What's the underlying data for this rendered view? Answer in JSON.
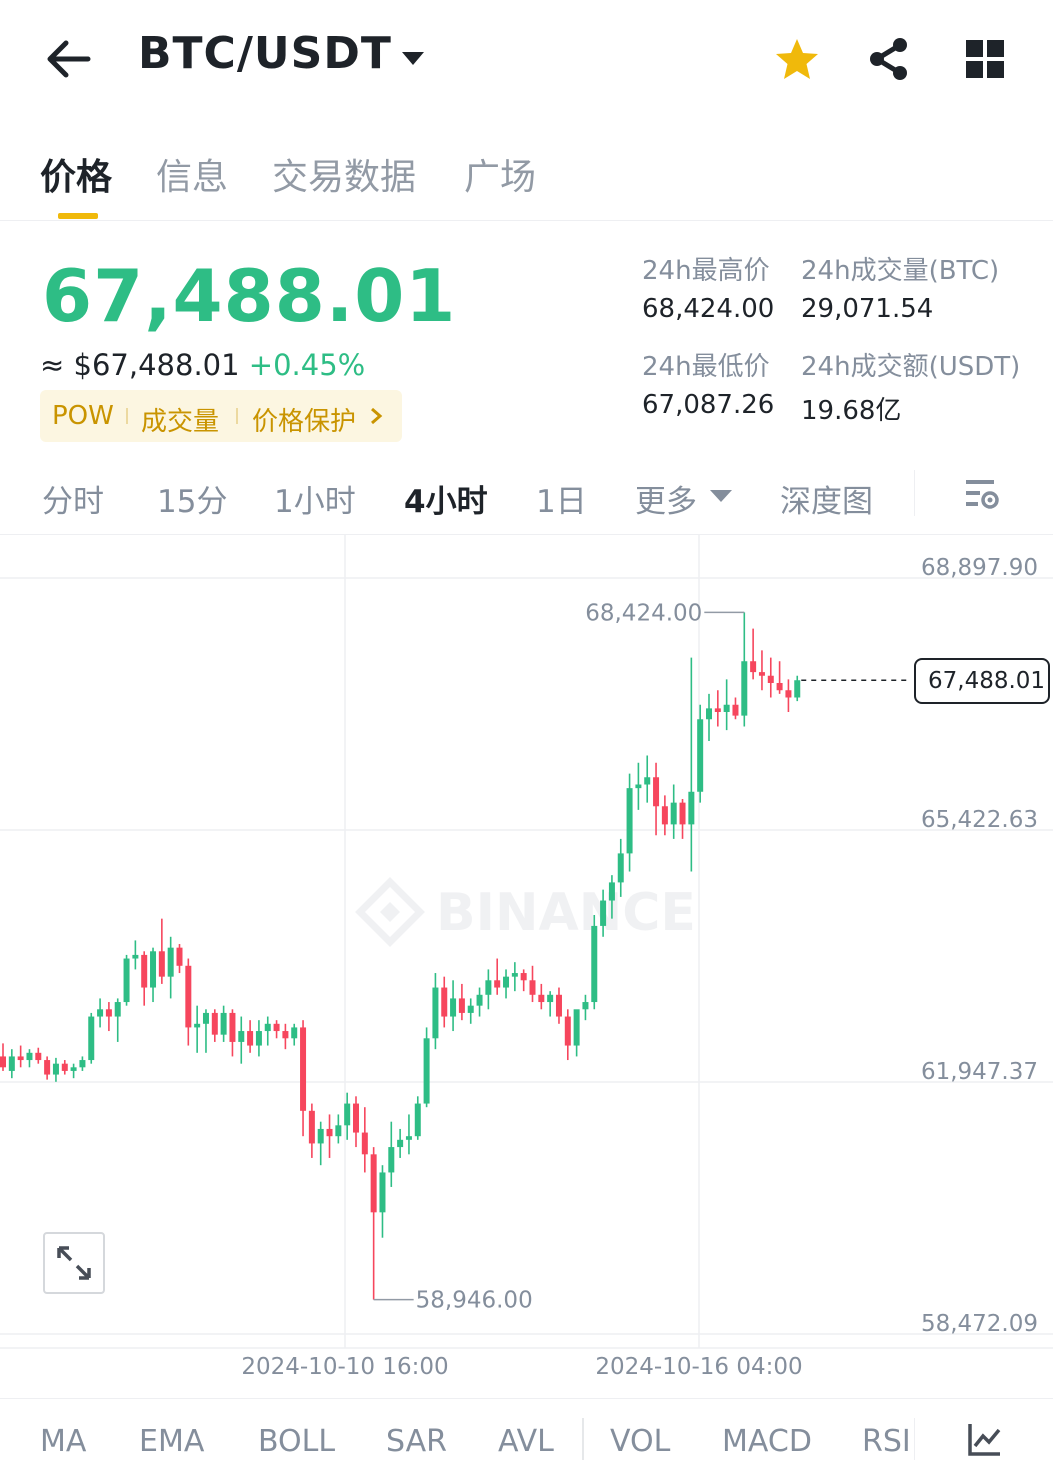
{
  "header": {
    "title": "BTC/USDT",
    "icons": [
      "back-arrow-icon",
      "chevron-down-icon",
      "star-icon",
      "share-icon",
      "grid-icon"
    ],
    "star_color": "#f0b90b"
  },
  "tabs": [
    {
      "label": "价格",
      "active": true
    },
    {
      "label": "信息",
      "active": false
    },
    {
      "label": "交易数据",
      "active": false
    },
    {
      "label": "广场",
      "active": false
    }
  ],
  "price": {
    "last": "67,488.01",
    "approx": "≈ $67,488.01",
    "change": "+0.45%",
    "up_color": "#2ebd85",
    "down_color": "#f6465d"
  },
  "tags": [
    "POW",
    "成交量",
    "价格保护"
  ],
  "stats": {
    "high_label": "24h最高价",
    "high_value": "68,424.00",
    "vol_btc_label": "24h成交量(BTC)",
    "vol_btc_value": "29,071.54",
    "low_label": "24h最低价",
    "low_value": "67,087.26",
    "vol_usdt_label": "24h成交额(USDT)",
    "vol_usdt_value": "19.68亿"
  },
  "intervals": [
    {
      "label": "分时",
      "active": false
    },
    {
      "label": "15分",
      "active": false
    },
    {
      "label": "1小时",
      "active": false
    },
    {
      "label": "4小时",
      "active": true
    },
    {
      "label": "1日",
      "active": false
    },
    {
      "label": "更多",
      "active": false
    },
    {
      "label": "深度图",
      "active": false
    }
  ],
  "chart": {
    "watermark": "BINANCE",
    "y_ticks": [
      "68,897.90",
      "65,422.63",
      "61,947.37",
      "58,472.09"
    ],
    "x_ticks": [
      "2024-10-10 16:00",
      "2024-10-16 04:00"
    ],
    "high_marker": "68,424.00",
    "low_marker": "58,946.00",
    "last_price": "67,488.01"
  },
  "chart_data": {
    "type": "candlestick",
    "interval": "4小时",
    "y_ticks": [
      68897.9,
      65422.63,
      61947.37,
      58472.09
    ],
    "x_ticks": [
      "2024-10-10 16:00",
      "2024-10-16 04:00"
    ],
    "high": 68424.0,
    "low": 58946.0,
    "last": 67488.01,
    "candles": [
      {
        "o": 62300,
        "h": 62480,
        "l": 62100,
        "c": 62150
      },
      {
        "o": 62100,
        "h": 62400,
        "l": 62000,
        "c": 62300
      },
      {
        "o": 62300,
        "h": 62450,
        "l": 62150,
        "c": 62250
      },
      {
        "o": 62250,
        "h": 62400,
        "l": 62150,
        "c": 62350
      },
      {
        "o": 62350,
        "h": 62420,
        "l": 62200,
        "c": 62250
      },
      {
        "o": 62250,
        "h": 62300,
        "l": 61980,
        "c": 62050
      },
      {
        "o": 62050,
        "h": 62280,
        "l": 61950,
        "c": 62200
      },
      {
        "o": 62200,
        "h": 62250,
        "l": 62050,
        "c": 62100
      },
      {
        "o": 62100,
        "h": 62200,
        "l": 62000,
        "c": 62150
      },
      {
        "o": 62150,
        "h": 62300,
        "l": 62100,
        "c": 62250
      },
      {
        "o": 62250,
        "h": 62900,
        "l": 62200,
        "c": 62850
      },
      {
        "o": 62850,
        "h": 63100,
        "l": 62700,
        "c": 62950
      },
      {
        "o": 62950,
        "h": 63050,
        "l": 62650,
        "c": 62850
      },
      {
        "o": 62850,
        "h": 63100,
        "l": 62500,
        "c": 63050
      },
      {
        "o": 63050,
        "h": 63700,
        "l": 63000,
        "c": 63650
      },
      {
        "o": 63650,
        "h": 63900,
        "l": 63500,
        "c": 63700
      },
      {
        "o": 63700,
        "h": 63750,
        "l": 63000,
        "c": 63250
      },
      {
        "o": 63250,
        "h": 63800,
        "l": 63050,
        "c": 63750
      },
      {
        "o": 63750,
        "h": 64200,
        "l": 63300,
        "c": 63400
      },
      {
        "o": 63400,
        "h": 63950,
        "l": 63100,
        "c": 63800
      },
      {
        "o": 63800,
        "h": 63850,
        "l": 63450,
        "c": 63550
      },
      {
        "o": 63550,
        "h": 63650,
        "l": 62450,
        "c": 62700
      },
      {
        "o": 62700,
        "h": 63000,
        "l": 62350,
        "c": 62750
      },
      {
        "o": 62750,
        "h": 62950,
        "l": 62350,
        "c": 62900
      },
      {
        "o": 62900,
        "h": 62950,
        "l": 62500,
        "c": 62600
      },
      {
        "o": 62600,
        "h": 63000,
        "l": 62500,
        "c": 62900
      },
      {
        "o": 62900,
        "h": 62950,
        "l": 62300,
        "c": 62500
      },
      {
        "o": 62500,
        "h": 62850,
        "l": 62200,
        "c": 62650
      },
      {
        "o": 62650,
        "h": 62800,
        "l": 62350,
        "c": 62450
      },
      {
        "o": 62450,
        "h": 62800,
        "l": 62300,
        "c": 62650
      },
      {
        "o": 62650,
        "h": 62850,
        "l": 62450,
        "c": 62750
      },
      {
        "o": 62750,
        "h": 62800,
        "l": 62550,
        "c": 62650
      },
      {
        "o": 62650,
        "h": 62750,
        "l": 62400,
        "c": 62550
      },
      {
        "o": 62550,
        "h": 62750,
        "l": 62450,
        "c": 62700
      },
      {
        "o": 62700,
        "h": 62800,
        "l": 61200,
        "c": 61550
      },
      {
        "o": 61550,
        "h": 61650,
        "l": 60900,
        "c": 61100
      },
      {
        "o": 61100,
        "h": 61400,
        "l": 60800,
        "c": 61300
      },
      {
        "o": 61300,
        "h": 61500,
        "l": 60900,
        "c": 61200
      },
      {
        "o": 61200,
        "h": 61500,
        "l": 61100,
        "c": 61350
      },
      {
        "o": 61350,
        "h": 61800,
        "l": 61150,
        "c": 61650
      },
      {
        "o": 61650,
        "h": 61750,
        "l": 61050,
        "c": 61250
      },
      {
        "o": 61250,
        "h": 61600,
        "l": 60700,
        "c": 60950
      },
      {
        "o": 60950,
        "h": 61050,
        "l": 58946,
        "c": 60150
      },
      {
        "o": 60150,
        "h": 60800,
        "l": 59800,
        "c": 60700
      },
      {
        "o": 60700,
        "h": 61400,
        "l": 60500,
        "c": 61050
      },
      {
        "o": 61050,
        "h": 61300,
        "l": 60900,
        "c": 61150
      },
      {
        "o": 61150,
        "h": 61500,
        "l": 60950,
        "c": 61200
      },
      {
        "o": 61200,
        "h": 61750,
        "l": 61150,
        "c": 61650
      },
      {
        "o": 61650,
        "h": 62700,
        "l": 61600,
        "c": 62550
      },
      {
        "o": 62550,
        "h": 63450,
        "l": 62400,
        "c": 63250
      },
      {
        "o": 63250,
        "h": 63400,
        "l": 62700,
        "c": 62850
      },
      {
        "o": 62850,
        "h": 63350,
        "l": 62650,
        "c": 63100
      },
      {
        "o": 63100,
        "h": 63300,
        "l": 62800,
        "c": 62900
      },
      {
        "o": 62900,
        "h": 63100,
        "l": 62750,
        "c": 63000
      },
      {
        "o": 63000,
        "h": 63250,
        "l": 62850,
        "c": 63150
      },
      {
        "o": 63150,
        "h": 63500,
        "l": 62950,
        "c": 63350
      },
      {
        "o": 63350,
        "h": 63650,
        "l": 63150,
        "c": 63250
      },
      {
        "o": 63250,
        "h": 63500,
        "l": 63100,
        "c": 63400
      },
      {
        "o": 63400,
        "h": 63600,
        "l": 63200,
        "c": 63450
      },
      {
        "o": 63450,
        "h": 63500,
        "l": 63200,
        "c": 63350
      },
      {
        "o": 63350,
        "h": 63550,
        "l": 63050,
        "c": 63150
      },
      {
        "o": 63150,
        "h": 63300,
        "l": 62950,
        "c": 63050
      },
      {
        "o": 63050,
        "h": 63200,
        "l": 62850,
        "c": 63150
      },
      {
        "o": 63150,
        "h": 63250,
        "l": 62750,
        "c": 62850
      },
      {
        "o": 62850,
        "h": 62950,
        "l": 62250,
        "c": 62450
      },
      {
        "o": 62450,
        "h": 62750,
        "l": 62300,
        "c": 62950
      },
      {
        "o": 62950,
        "h": 63150,
        "l": 62800,
        "c": 63050
      },
      {
        "o": 63050,
        "h": 64250,
        "l": 62950,
        "c": 64100
      },
      {
        "o": 64100,
        "h": 64600,
        "l": 63950,
        "c": 64450
      },
      {
        "o": 64450,
        "h": 64800,
        "l": 64200,
        "c": 64700
      },
      {
        "o": 64700,
        "h": 65300,
        "l": 64500,
        "c": 65100
      },
      {
        "o": 65100,
        "h": 66200,
        "l": 64850,
        "c": 66000
      },
      {
        "o": 66000,
        "h": 66350,
        "l": 65700,
        "c": 66050
      },
      {
        "o": 66050,
        "h": 66450,
        "l": 65800,
        "c": 66150
      },
      {
        "o": 66150,
        "h": 66350,
        "l": 65350,
        "c": 65750
      },
      {
        "o": 65750,
        "h": 65900,
        "l": 65350,
        "c": 65500
      },
      {
        "o": 65500,
        "h": 66050,
        "l": 65300,
        "c": 65800
      },
      {
        "o": 65800,
        "h": 65850,
        "l": 65300,
        "c": 65500
      },
      {
        "o": 65500,
        "h": 67800,
        "l": 64850,
        "c": 65950
      },
      {
        "o": 65950,
        "h": 67150,
        "l": 65800,
        "c": 66950
      },
      {
        "o": 66950,
        "h": 67300,
        "l": 66650,
        "c": 67100
      },
      {
        "o": 67100,
        "h": 67350,
        "l": 66850,
        "c": 67050
      },
      {
        "o": 67050,
        "h": 67500,
        "l": 66800,
        "c": 67150
      },
      {
        "o": 67150,
        "h": 67250,
        "l": 66950,
        "c": 67000
      },
      {
        "o": 67000,
        "h": 68424,
        "l": 66850,
        "c": 67750
      },
      {
        "o": 67750,
        "h": 68200,
        "l": 67500,
        "c": 67600
      },
      {
        "o": 67600,
        "h": 67900,
        "l": 67350,
        "c": 67550
      },
      {
        "o": 67550,
        "h": 67800,
        "l": 67250,
        "c": 67450
      },
      {
        "o": 67450,
        "h": 67750,
        "l": 67300,
        "c": 67350
      },
      {
        "o": 67350,
        "h": 67500,
        "l": 67050,
        "c": 67250
      },
      {
        "o": 67250,
        "h": 67550,
        "l": 67200,
        "c": 67488.01
      }
    ]
  },
  "indicators": [
    "MA",
    "EMA",
    "BOLL",
    "SAR",
    "AVL",
    "VOL",
    "MACD",
    "RSI"
  ]
}
